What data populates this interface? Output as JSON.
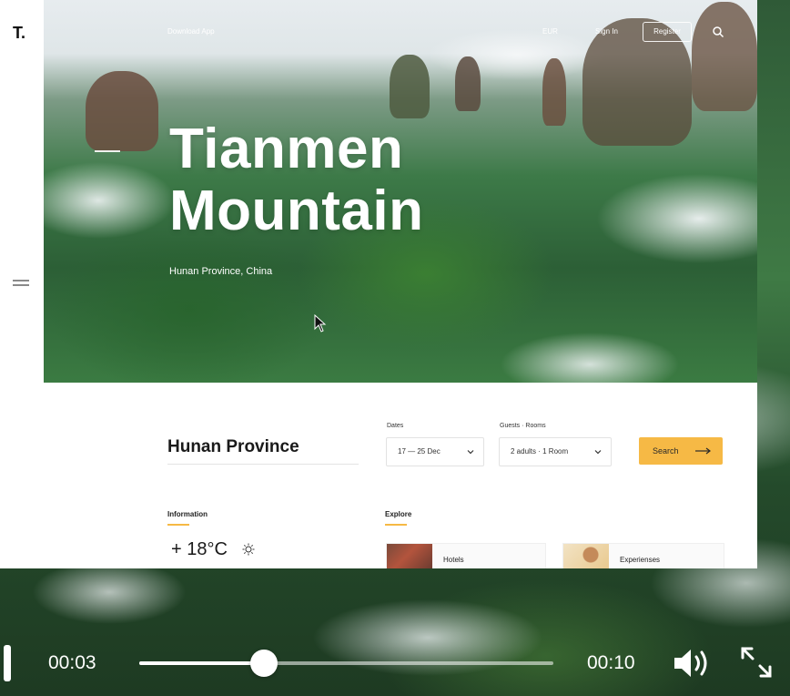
{
  "app": {
    "logo": "T.",
    "nav": {
      "download": "Download App",
      "language": "EUR",
      "sign_in": "Sign In",
      "register": "Register"
    }
  },
  "hero": {
    "title_line1": "Tianmen",
    "title_line2": "Mountain",
    "subtitle": "Hunan Province, China"
  },
  "booking": {
    "destination": "Hunan Province",
    "dates_label": "Dates",
    "dates_value": "17 — 25 Dec",
    "guests_label": "Guests · Rooms",
    "guests_value": "2 adults · 1 Room",
    "search_label": "Search"
  },
  "information": {
    "label": "Information",
    "temperature": "+ 18°C"
  },
  "explore": {
    "label": "Explore",
    "items": [
      {
        "label": "Hotels"
      },
      {
        "label": "Experienses"
      }
    ]
  },
  "player": {
    "current_time": "00:03",
    "duration": "00:10",
    "progress": 0.3
  },
  "colors": {
    "accent": "#f6b945",
    "white": "#ffffff"
  },
  "icons": [
    "menu-icon",
    "search-icon",
    "chevron-down-icon",
    "arrow-right-icon",
    "sun-icon",
    "volume-icon",
    "fullscreen-icon",
    "cursor-icon"
  ]
}
